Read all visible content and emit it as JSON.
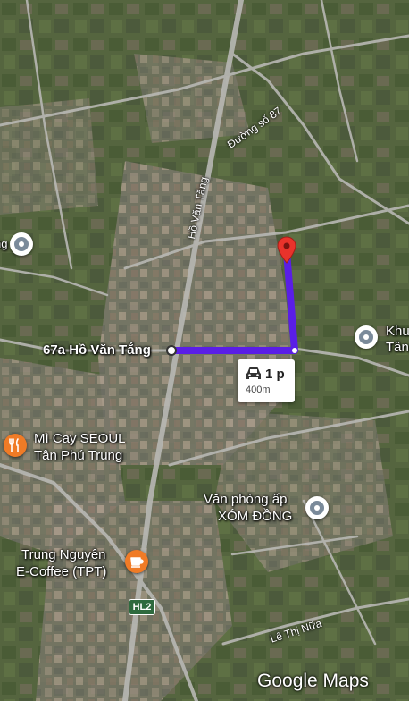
{
  "streets": {
    "duong_so_87": "Đường số 87",
    "ho_van_tang": "Hồ Văn Tắng",
    "le_thi_nua": "Lê Thị Nữa"
  },
  "places": {
    "start_label": "67a Hồ Văn Tắng",
    "khu_line1": "Khu",
    "khu_line2": "Tân",
    "mi_cay_line1": "Mì Cay SEOUL",
    "mi_cay_line2": "Tân Phú Trung",
    "van_phong_line1": "Văn phòng ấp",
    "van_phong_line2": "XÓM ĐỒNG",
    "trung_nguyen_line1": "Trung Nguyên",
    "trung_nguyen_line2": "E-Coffee (TPT)",
    "edge_fragment": "ng"
  },
  "route": {
    "time": "1 p",
    "distance": "400m",
    "color": "#5a1ee6",
    "mode_icon": "car-icon"
  },
  "road_badge": "HL2",
  "logo": "Google Maps",
  "icons": {
    "place": "place-pin-icon",
    "restaurant": "fork-knife-icon",
    "cafe": "coffee-cup-icon",
    "destination": "red-destination-pin-icon"
  }
}
